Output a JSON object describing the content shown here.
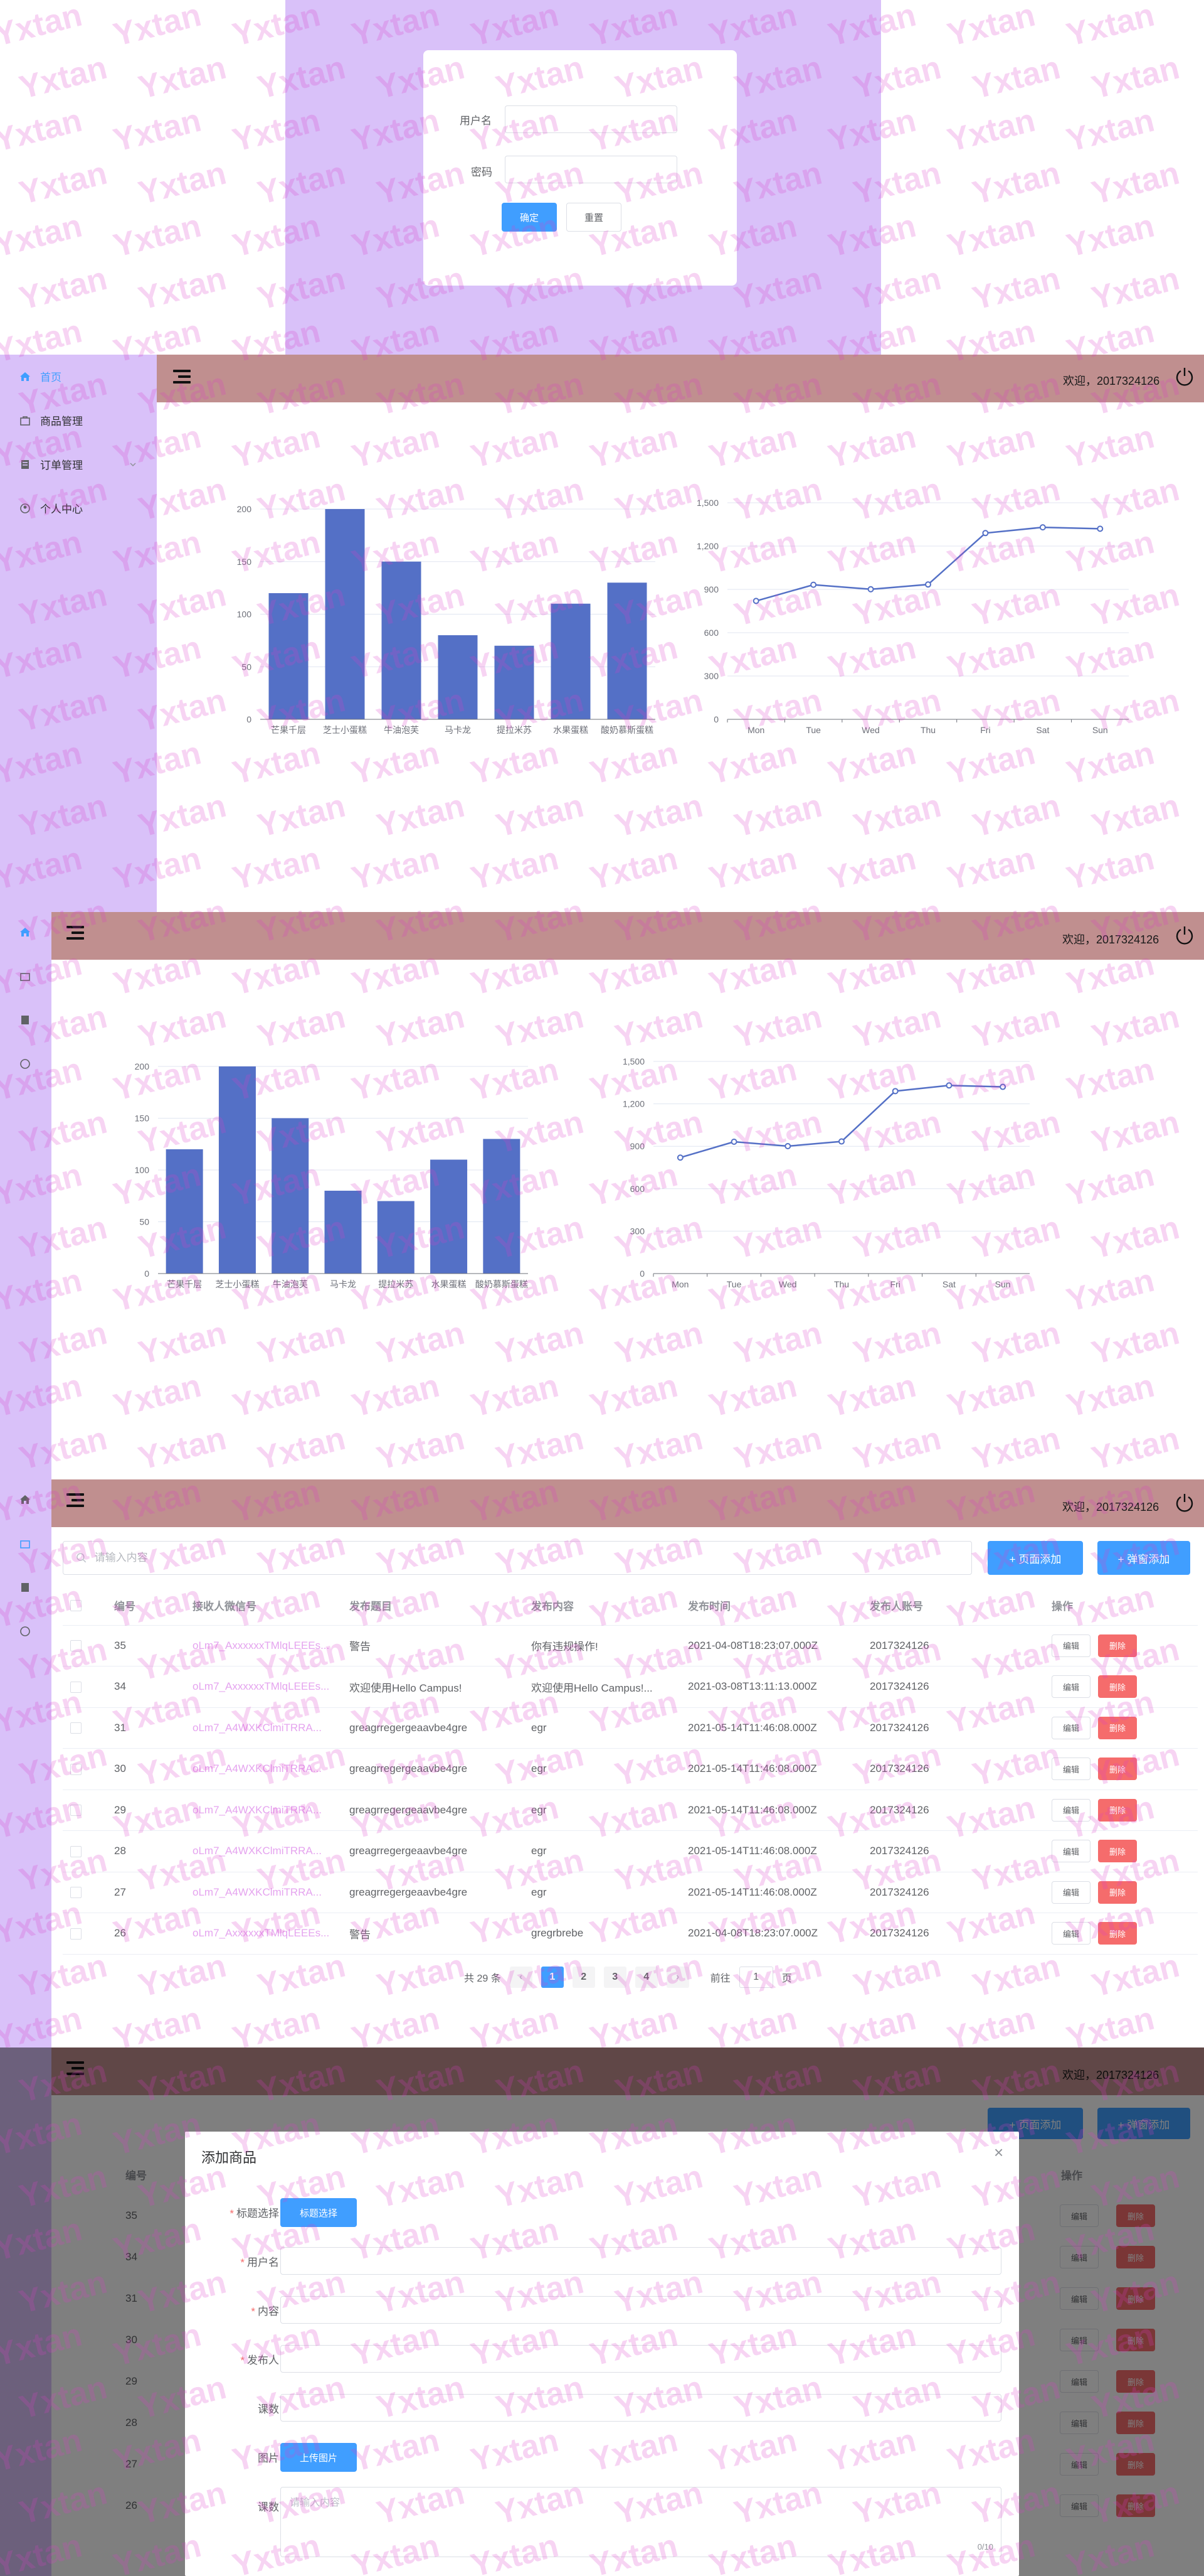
{
  "login": {
    "username_label": "用户名",
    "password_label": "密码",
    "confirm_label": "确定",
    "reset_label": "重置"
  },
  "header": {
    "welcome_full": "欢迎，2017324126",
    "welcome_clipped": "欢迎，2017324126"
  },
  "sidebar": {
    "items": [
      {
        "label": "首页",
        "icon": "home-icon"
      },
      {
        "label": "商品管理",
        "icon": "goods-icon"
      },
      {
        "label": "订单管理",
        "icon": "order-icon"
      },
      {
        "label": "个人中心",
        "icon": "user-icon"
      }
    ]
  },
  "bar_chart_data": {
    "type": "bar",
    "categories": [
      "芒果千层",
      "芝士小蛋糕",
      "牛油泡芙",
      "马卡龙",
      "提拉米苏",
      "水果蛋糕",
      "酸奶慕斯蛋糕"
    ],
    "values": [
      120,
      200,
      150,
      80,
      70,
      110,
      130
    ],
    "ylim": [
      0,
      200
    ],
    "yticks": [
      0,
      50,
      100,
      150,
      200
    ],
    "color": "#5470c6"
  },
  "line_chart_data": {
    "type": "line",
    "categories": [
      "Mon",
      "Tue",
      "Wed",
      "Thu",
      "Fri",
      "Sat",
      "Sun"
    ],
    "values": [
      820,
      932,
      901,
      934,
      1290,
      1330,
      1320
    ],
    "ylim": [
      0,
      1500
    ],
    "yticks": [
      "0",
      "300",
      "600",
      "900",
      "1,200",
      "1,500"
    ],
    "color": "#5470c6"
  },
  "chart_data": [
    {
      "type": "bar",
      "categories": [
        "芒果千层",
        "芝士小蛋糕",
        "牛油泡芙",
        "马卡龙",
        "提拉米苏",
        "水果蛋糕",
        "酸奶慕斯蛋糕"
      ],
      "values": [
        120,
        200,
        150,
        80,
        70,
        110,
        130
      ],
      "ylim": [
        0,
        200
      ]
    },
    {
      "type": "line",
      "categories": [
        "Mon",
        "Tue",
        "Wed",
        "Thu",
        "Fri",
        "Sat",
        "Sun"
      ],
      "values": [
        820,
        932,
        901,
        934,
        1290,
        1330,
        1320
      ],
      "ylim": [
        0,
        1500
      ]
    }
  ],
  "table": {
    "search_placeholder": "请输入内容",
    "page_add_label": "+ 页面添加",
    "dialog_add_label": "+ 弹窗添加",
    "columns": [
      "编号",
      "接收人微信号",
      "发布题目",
      "发布内容",
      "发布时间",
      "发布人账号",
      "操作"
    ],
    "edit_label": "编辑",
    "delete_label": "删除",
    "rows": [
      {
        "id": "35",
        "wechat": "oLm7_AxxxxxxTMlqLEEEs...",
        "title": "警告",
        "content": "你有违规操作!",
        "time": "2021-04-08T18:23:07.000Z",
        "account": "2017324126"
      },
      {
        "id": "34",
        "wechat": "oLm7_AxxxxxxTMlqLEEEs...",
        "title": "欢迎使用Hello Campus!",
        "content": "欢迎使用Hello Campus!...",
        "time": "2021-03-08T13:11:13.000Z",
        "account": "2017324126"
      },
      {
        "id": "31",
        "wechat": "oLm7_A4WXKClmiTRRA...",
        "title": "greagrregergeaavbe4gre",
        "content": "egr",
        "time": "2021-05-14T11:46:08.000Z",
        "account": "2017324126"
      },
      {
        "id": "30",
        "wechat": "oLm7_A4WXKClmiTRRA...",
        "title": "greagrregergeaavbe4gre",
        "content": "egr",
        "time": "2021-05-14T11:46:08.000Z",
        "account": "2017324126"
      },
      {
        "id": "29",
        "wechat": "oLm7_A4WXKClmiTRRA...",
        "title": "greagrregergeaavbe4gre",
        "content": "egr",
        "time": "2021-05-14T11:46:08.000Z",
        "account": "2017324126"
      },
      {
        "id": "28",
        "wechat": "oLm7_A4WXKClmiTRRA...",
        "title": "greagrregergeaavbe4gre",
        "content": "egr",
        "time": "2021-05-14T11:46:08.000Z",
        "account": "2017324126"
      },
      {
        "id": "27",
        "wechat": "oLm7_A4WXKClmiTRRA...",
        "title": "greagrregergeaavbe4gre",
        "content": "egr",
        "time": "2021-05-14T11:46:08.000Z",
        "account": "2017324126"
      },
      {
        "id": "26",
        "wechat": "oLm7_AxxxxxxTMlqLEEEs...",
        "title": "警告",
        "content": "gregrbrebe",
        "time": "2021-04-08T18:23:07.000Z",
        "account": "2017324126"
      }
    ],
    "pagination": {
      "total": "共 29 条",
      "pages": [
        "1",
        "2",
        "3",
        "4"
      ],
      "current": "1",
      "goto_label": "前往",
      "goto_value": "1",
      "page_suffix": "页"
    }
  },
  "dialog": {
    "title": "添加商品",
    "close": "×",
    "fields": [
      {
        "label": "标题选择",
        "required": true,
        "kind": "button",
        "button_label": "标题选择"
      },
      {
        "label": "用户名",
        "required": true,
        "kind": "input"
      },
      {
        "label": "内容",
        "required": true,
        "kind": "input"
      },
      {
        "label": "发布人",
        "required": true,
        "kind": "input"
      },
      {
        "label": "课数",
        "required": false,
        "kind": "input"
      },
      {
        "label": "图片",
        "required": false,
        "kind": "button",
        "button_label": "上传图片"
      },
      {
        "label": "课数",
        "required": false,
        "kind": "textarea",
        "placeholder": "请输入内容",
        "counter": "0/10"
      }
    ],
    "bg_row_ids": [
      "35",
      "34",
      "31",
      "30",
      "29",
      "28",
      "27",
      "26"
    ],
    "bg_col_id": "编号",
    "bg_col_ops": "操作"
  },
  "watermark": "Yxtan",
  "colors": {
    "purple": "#d9c1f9",
    "header": "#c08f8f",
    "primary": "#409eff",
    "danger": "#f56c6c",
    "chart": "#5470c6"
  }
}
